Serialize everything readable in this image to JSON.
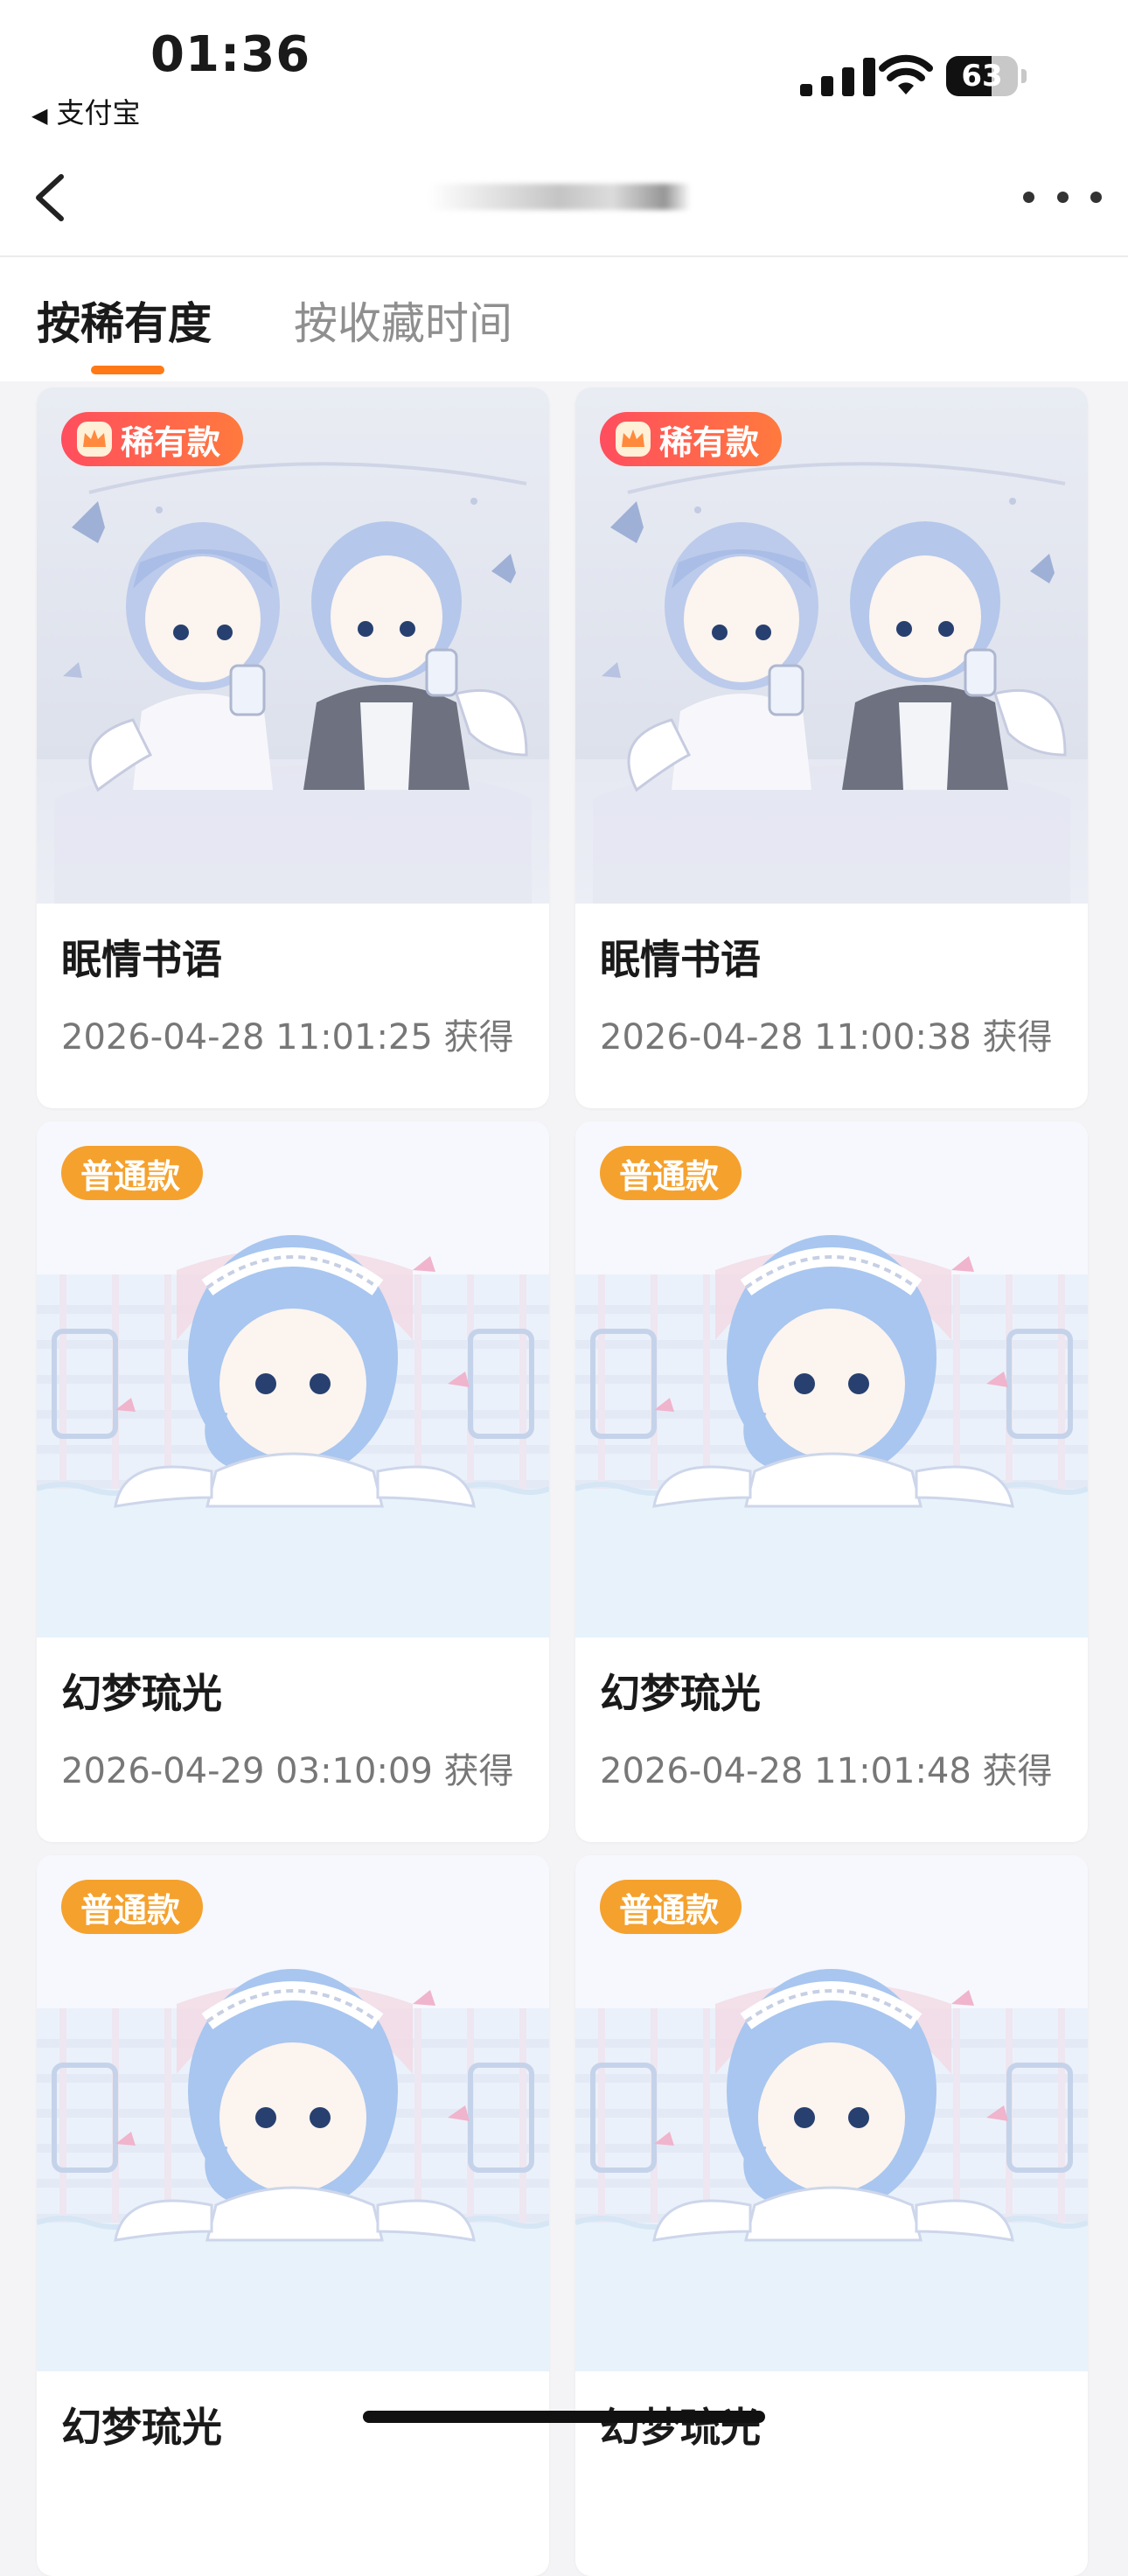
{
  "status_bar": {
    "time": "01:36",
    "back_app": "支付宝",
    "battery": "63",
    "battery_level": 0.63
  },
  "nav": {
    "title": ""
  },
  "tabs": [
    {
      "label": "按稀有度"
    },
    {
      "label": "按收藏时间"
    }
  ],
  "cards": [
    {
      "badge": "稀有款",
      "tier": "rare",
      "name": "眠情书语",
      "date": "2026-04-28 11:01:25 获得"
    },
    {
      "badge": "稀有款",
      "tier": "rare",
      "name": "眠情书语",
      "date": "2026-04-28 11:00:38 获得"
    },
    {
      "badge": "普通款",
      "tier": "normal",
      "name": "幻梦琉光",
      "date": "2026-04-29 03:10:09 获得"
    },
    {
      "badge": "普通款",
      "tier": "normal",
      "name": "幻梦琉光",
      "date": "2026-04-28 11:01:48 获得"
    },
    {
      "badge": "普通款",
      "tier": "normal",
      "name": "幻梦琉光",
      "date": ""
    },
    {
      "badge": "普通款",
      "tier": "normal",
      "name": "幻梦琉光",
      "date": ""
    }
  ],
  "colors": {
    "accent": "#ff7a16",
    "rare_badge": "#ff4d5e",
    "normal_badge": "#f5a12d"
  }
}
